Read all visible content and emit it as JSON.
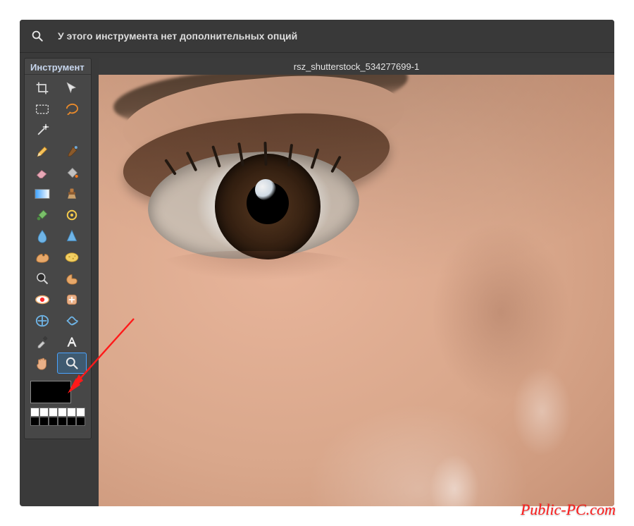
{
  "optionsbar": {
    "icon": "zoom-icon",
    "message": "У этого инструмента нет дополнительных опций"
  },
  "tools_panel": {
    "title": "Инструмент",
    "tools": [
      {
        "name": "crop",
        "label": "crop-tool"
      },
      {
        "name": "move",
        "label": "move-tool"
      },
      {
        "name": "marquee",
        "label": "marquee-select-tool"
      },
      {
        "name": "lasso",
        "label": "lasso-select-tool"
      },
      {
        "name": "wand",
        "label": "magic-wand-tool"
      },
      {
        "name": "spacer1",
        "label": ""
      },
      {
        "name": "pencil",
        "label": "pencil-tool"
      },
      {
        "name": "brush",
        "label": "brush-tool"
      },
      {
        "name": "eraser",
        "label": "eraser-tool"
      },
      {
        "name": "bucket",
        "label": "paint-bucket-tool"
      },
      {
        "name": "gradient",
        "label": "gradient-tool"
      },
      {
        "name": "clone",
        "label": "clone-stamp-tool"
      },
      {
        "name": "replace",
        "label": "color-replace-tool"
      },
      {
        "name": "draw",
        "label": "drawing-tool"
      },
      {
        "name": "blur",
        "label": "blur-tool"
      },
      {
        "name": "sharpen",
        "label": "sharpen-tool"
      },
      {
        "name": "smudge",
        "label": "smudge-tool"
      },
      {
        "name": "sponge",
        "label": "sponge-tool"
      },
      {
        "name": "dodge",
        "label": "dodge-tool"
      },
      {
        "name": "burn",
        "label": "burn-tool"
      },
      {
        "name": "redeye",
        "label": "red-eye-tool"
      },
      {
        "name": "spot",
        "label": "spot-heal-tool"
      },
      {
        "name": "bloat",
        "label": "bloat-tool"
      },
      {
        "name": "pinch",
        "label": "pinch-tool"
      },
      {
        "name": "picker",
        "label": "colorpicker-tool"
      },
      {
        "name": "type",
        "label": "type-tool"
      },
      {
        "name": "hand",
        "label": "hand-tool"
      },
      {
        "name": "zoom",
        "label": "zoom-tool"
      }
    ],
    "selected": "zoom",
    "colors": {
      "foreground": "#000000",
      "background": "#ffffff"
    }
  },
  "document": {
    "tab_title": "rsz_shutterstock_534277699-1"
  },
  "annotation": {
    "arrow_target": "zoom-tool"
  },
  "watermark": "Public-PC.com"
}
